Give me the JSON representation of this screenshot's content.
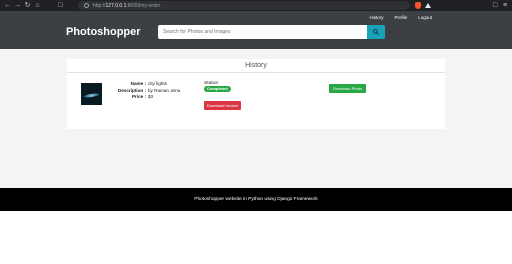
{
  "browser": {
    "url_prefix": "http://",
    "url_host": "127.0.0.1",
    "url_rest": ":8000/my-order"
  },
  "header": {
    "brand": "Photoshopper",
    "nav": [
      "History",
      "Profile",
      "Logout"
    ],
    "search_placeholder": "Search for Photos and Images"
  },
  "history": {
    "title": "History",
    "order": {
      "name_label": "Name :",
      "name_value": "city lights",
      "description_label": "Description :",
      "description_value": "by Raman Jena",
      "price_label": "Price :",
      "price_value": "$3",
      "status_label": "Status:",
      "status_value": "Completed",
      "download_invoice_label": "Download Invoice",
      "download_photo_label": "Download Photo"
    }
  },
  "footer": {
    "text": "Photoshopper website in Python using Django Framework"
  },
  "colors": {
    "header_bg": "#3c4045",
    "search_button": "#17a2b8",
    "success": "#28a745",
    "danger": "#dc3545",
    "footer_bg": "#000000"
  },
  "icons": [
    "back-icon",
    "forward-icon",
    "reload-icon",
    "home-icon",
    "bookmark-icon",
    "lock-icon",
    "brave-shield-icon",
    "rewards-icon",
    "search-icon"
  ]
}
